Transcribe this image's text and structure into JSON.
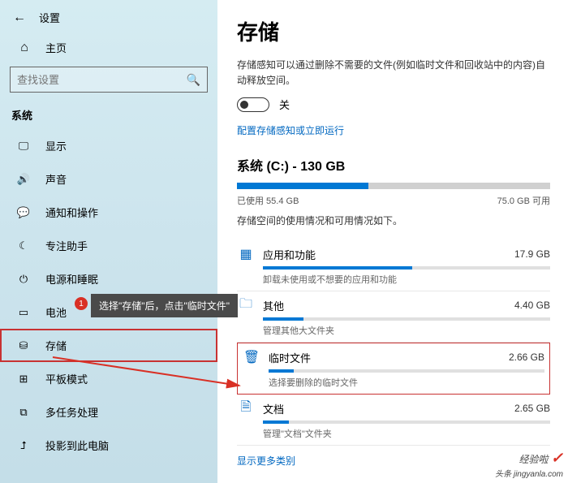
{
  "header": {
    "title": "设置"
  },
  "home": {
    "label": "主页"
  },
  "search": {
    "placeholder": "查找设置"
  },
  "section": {
    "label": "系统"
  },
  "nav": [
    {
      "icon": "display-icon",
      "glyph": "🖵",
      "label": "显示"
    },
    {
      "icon": "sound-icon",
      "glyph": "🔊",
      "label": "声音"
    },
    {
      "icon": "notifications-icon",
      "glyph": "💬",
      "label": "通知和操作"
    },
    {
      "icon": "focus-icon",
      "glyph": "☾",
      "label": "专注助手"
    },
    {
      "icon": "power-icon",
      "glyph": "⏻",
      "label": "电源和睡眠"
    },
    {
      "icon": "battery-icon",
      "glyph": "▭",
      "label": "电池"
    },
    {
      "icon": "storage-icon",
      "glyph": "⛁",
      "label": "存储",
      "selected": true
    },
    {
      "icon": "tablet-icon",
      "glyph": "⊞",
      "label": "平板模式"
    },
    {
      "icon": "multitask-icon",
      "glyph": "⧉",
      "label": "多任务处理"
    },
    {
      "icon": "project-icon",
      "glyph": "⮥",
      "label": "投影到此电脑"
    }
  ],
  "main": {
    "heading": "存储",
    "description": "存储感知可以通过删除不需要的文件(例如临时文件和回收站中的内容)自动释放空间。",
    "toggle_label": "关",
    "config_link": "配置存储感知或立即运行",
    "drive_title": "系统 (C:) - 130 GB",
    "used": "已使用 55.4 GB",
    "free": "75.0 GB 可用",
    "usage_desc": "存储空间的使用情况和可用情况如下。",
    "categories": [
      {
        "icon": "apps-icon",
        "glyph": "▦",
        "name": "应用和功能",
        "size": "17.9 GB",
        "fill": 52,
        "sub": "卸载未使用或不想要的应用和功能"
      },
      {
        "icon": "other-icon",
        "glyph": "🗀",
        "name": "其他",
        "size": "4.40 GB",
        "fill": 14,
        "sub": "管理其他大文件夹"
      },
      {
        "icon": "temp-icon",
        "glyph": "🗑",
        "name": "临时文件",
        "size": "2.66 GB",
        "fill": 9,
        "sub": "选择要删除的临时文件",
        "highlight": true
      },
      {
        "icon": "docs-icon",
        "glyph": "🗎",
        "name": "文档",
        "size": "2.65 GB",
        "fill": 9,
        "sub": "管理\"文档\"文件夹"
      }
    ],
    "show_more": "显示更多类别"
  },
  "annotation": {
    "number": "1",
    "tooltip": "选择\"存储\"后，点击\"临时文件\""
  },
  "watermark": {
    "brand": "经验啦",
    "sub": "头条 jingyanla.com"
  }
}
